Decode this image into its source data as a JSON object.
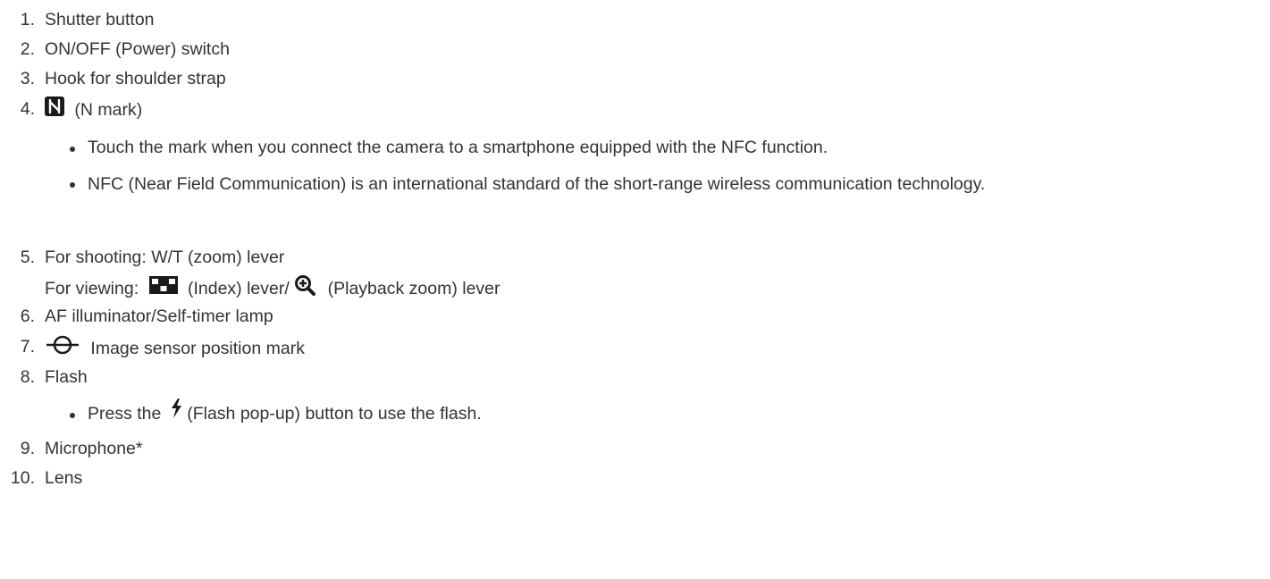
{
  "items": [
    {
      "num": "1.",
      "text": "Shutter button"
    },
    {
      "num": "2.",
      "text": "ON/OFF (Power) switch"
    },
    {
      "num": "3.",
      "text": "Hook for shoulder strap"
    },
    {
      "num": "4.",
      "text": "(N mark)",
      "icon": "n-mark-icon",
      "bullets": [
        "Touch the mark when you connect the camera to a smartphone equipped with the NFC function.",
        "NFC (Near Field Communication) is an international standard of the short-range wireless communication technology."
      ]
    },
    {
      "num": "5.",
      "line1": "For shooting: W/T (zoom) lever",
      "line2_prefix": "For viewing:",
      "index_icon": "index-icon",
      "line2_mid": "(Index) lever/",
      "zoom_icon": "playback-zoom-icon",
      "line2_suffix": "(Playback zoom) lever"
    },
    {
      "num": "6.",
      "text": "AF illuminator/Self-timer lamp"
    },
    {
      "num": "7.",
      "text": "Image sensor position mark",
      "icon": "image-sensor-position-icon"
    },
    {
      "num": "8.",
      "text": "Flash",
      "bullet_prefix": "Press the",
      "bullet_icon": "flash-icon",
      "bullet_suffix": "(Flash pop-up) button to use the flash."
    },
    {
      "num": "9.",
      "text": "Microphone*"
    },
    {
      "num": "10.",
      "text": "Lens"
    }
  ]
}
